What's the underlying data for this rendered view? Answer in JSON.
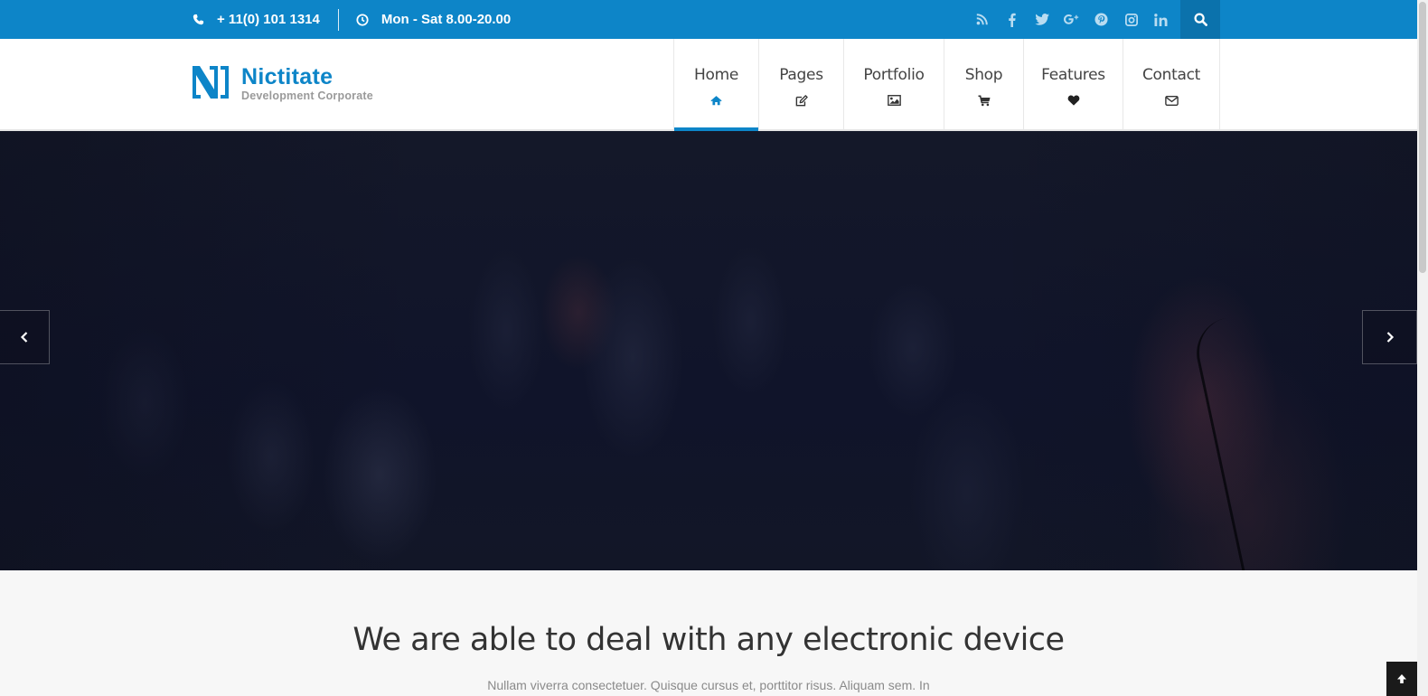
{
  "topbar": {
    "phone": "+ 11(0) 101 1314",
    "hours": "Mon - Sat 8.00-20.00",
    "social": [
      {
        "icon": "rss-icon",
        "glyph": "◢"
      },
      {
        "icon": "facebook-icon",
        "glyph": "f"
      },
      {
        "icon": "twitter-icon",
        "glyph": "t"
      },
      {
        "icon": "google-plus-icon",
        "glyph": "g+"
      },
      {
        "icon": "pinterest-icon",
        "glyph": "p"
      },
      {
        "icon": "instagram-icon",
        "glyph": "▣"
      },
      {
        "icon": "linkedin-icon",
        "glyph": "in"
      }
    ]
  },
  "brand": {
    "name": "Nictitate",
    "tagline": "Development Corporate",
    "color": "#0d85c8"
  },
  "nav": {
    "items": [
      {
        "label": "Home",
        "icon": "home-icon"
      },
      {
        "label": "Pages",
        "icon": "edit-icon"
      },
      {
        "label": "Portfolio",
        "icon": "image-icon"
      },
      {
        "label": "Shop",
        "icon": "cart-icon"
      },
      {
        "label": "Features",
        "icon": "heart-icon"
      },
      {
        "label": "Contact",
        "icon": "envelope-icon"
      }
    ],
    "active": "Home"
  },
  "intro": {
    "heading": "We are able to deal with any electronic device",
    "text": "Nullam viverra consectetuer. Quisque cursus et, porttitor risus. Aliquam sem. In"
  }
}
